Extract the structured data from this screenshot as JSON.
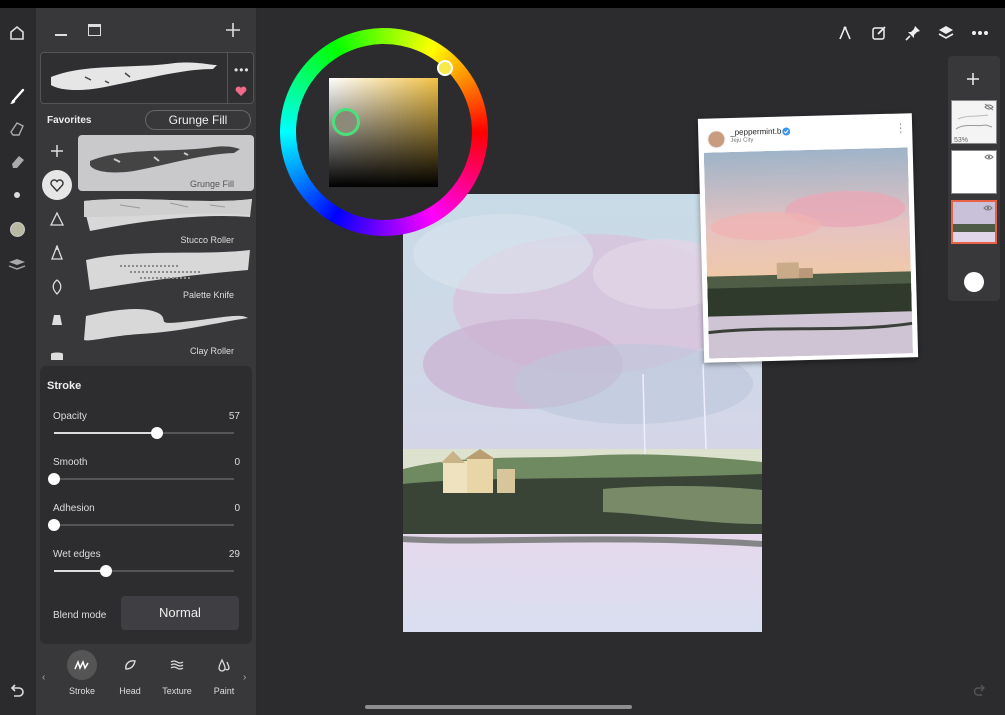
{
  "panel": {
    "favorites_label": "Favorites",
    "current_brush": "Grunge Fill",
    "brushes": [
      {
        "name": "Grunge Fill"
      },
      {
        "name": "Stucco Roller"
      },
      {
        "name": "Palette Knife"
      },
      {
        "name": "Clay Roller"
      }
    ]
  },
  "stroke": {
    "title": "Stroke",
    "sliders": [
      {
        "label": "Opacity",
        "value": "57",
        "level": 0.57
      },
      {
        "label": "Smooth",
        "value": "0",
        "level": 0
      },
      {
        "label": "Adhesion",
        "value": "0",
        "level": 0
      },
      {
        "label": "Wet edges",
        "value": "29",
        "level": 0.29
      }
    ],
    "blend_label": "Blend mode",
    "blend_value": "Normal"
  },
  "tabs": [
    {
      "label": "Stroke",
      "icon": "stroke-icon"
    },
    {
      "label": "Head",
      "icon": "head-icon"
    },
    {
      "label": "Texture",
      "icon": "texture-icon"
    },
    {
      "label": "Paint",
      "icon": "paint-icon"
    }
  ],
  "reference": {
    "username": "_peppermint.b",
    "location": "Jeju City"
  },
  "layers": {
    "opacity_label": "53%"
  },
  "colors": {
    "accent": "#e8624a",
    "favorite_heart": "#f06b8a",
    "panel_bg": "#38383b",
    "canvas_bg": "#2c2c2f"
  }
}
